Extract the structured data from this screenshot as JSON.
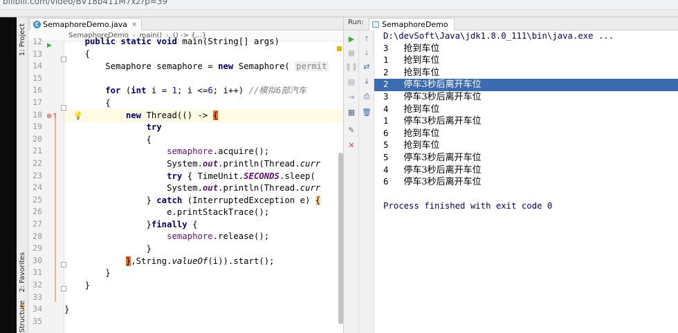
{
  "browser": {
    "url": "bilibili.com/video/BV18b411M7xz?p=39"
  },
  "sidebar": {
    "project_label": "1: Project",
    "favorites_label": "2: Favorites",
    "structure_label": "Structure"
  },
  "editor": {
    "tab_label": "SemaphoreDemo.java",
    "tab_close": "×",
    "file_icon": "c-class-icon",
    "breadcrumb": [
      "SemaphoreDemo",
      "main()",
      "() -> {...}"
    ],
    "crumb_sep": "›",
    "line_numbers": [
      "12",
      "13",
      "14",
      "15",
      "16",
      "17",
      "18",
      "19",
      "20",
      "21",
      "22",
      "23",
      "24",
      "25",
      "26",
      "27",
      "28",
      "29",
      "30",
      "31",
      "32",
      "33",
      "34",
      "35"
    ],
    "code": {
      "l12_a": "    ",
      "l12_kw": "public static void",
      "l12_b": " main(String[] args)",
      "l13": "    {",
      "l14_a": "        Semaphore semaphore = ",
      "l14_kw": "new",
      "l14_b": " Semaphore( ",
      "l14_hint": "permit",
      "l16_a": "        ",
      "l16_kw1": "for",
      "l16_b": " (",
      "l16_kw2": "int",
      "l16_c": " i = ",
      "l16_n1": "1",
      "l16_d": "; i <=",
      "l16_n2": "6",
      "l16_e": "; i++) ",
      "l16_cmt": "//模拟6部汽车",
      "l17": "        {",
      "l18_a": "            ",
      "l18_kw": "new",
      "l18_b": " Thread(() -> ",
      "l18_brace": "{",
      "l19_a": "                ",
      "l19_kw": "try",
      "l20": "                {",
      "l21_a": "                    ",
      "l21_fld": "semaphore",
      "l21_b": ".acquire();",
      "l22_a": "                    System.",
      "l22_fld": "out",
      "l22_b": ".println(Thread.",
      "l22_c": "curr",
      "l23_a": "                    ",
      "l23_kw": "try",
      "l23_b": " { TimeUnit.",
      "l23_fld": "SECONDS",
      "l23_c": ".sleep(",
      "l24_a": "                    System.",
      "l24_fld": "out",
      "l24_b": ".println(Thread.",
      "l24_c": "curr",
      "l25_a": "                } ",
      "l25_kw": "catch",
      "l25_b": " (InterruptedException e) ",
      "l25_brace": "{",
      "l26": "                    e.printStackTrace();",
      "l27_a": "                }",
      "l27_kw": "finally",
      "l27_b": " {",
      "l28_a": "                    ",
      "l28_fld": "semaphore",
      "l28_b": ".release();",
      "l29": "                }",
      "l30_a": "            ",
      "l30_brace": "}",
      "l30_b": ",String.",
      "l30_it": "valueOf",
      "l30_c": "(i)).start();",
      "l31": "        }",
      "l32": "    }",
      "l34": "}"
    }
  },
  "run_panel": {
    "label": "Run:",
    "tab_label": "SemaphoreDemo",
    "command": "D:\\devSoft\\Java\\jdk1.8.0_111\\bin\\java.exe ...",
    "output": [
      {
        "n": "3",
        "msg": "抢到车位"
      },
      {
        "n": "1",
        "msg": "抢到车位"
      },
      {
        "n": "2",
        "msg": "抢到车位"
      },
      {
        "n": "2",
        "msg": "停车3秒后离开车位"
      },
      {
        "n": "3",
        "msg": "停车3秒后离开车位"
      },
      {
        "n": "4",
        "msg": "抢到车位"
      },
      {
        "n": "1",
        "msg": "停车3秒后离开车位"
      },
      {
        "n": "6",
        "msg": "抢到车位"
      },
      {
        "n": "5",
        "msg": "抢到车位"
      },
      {
        "n": "5",
        "msg": "停车3秒后离开车位"
      },
      {
        "n": "4",
        "msg": "停车3秒后离开车位"
      },
      {
        "n": "6",
        "msg": "停车3秒后离开车位"
      }
    ],
    "exit_message": "Process finished with exit code 0",
    "toolbar_icons": [
      "rerun-icon",
      "stop-icon",
      "pause-icon",
      "dump-threads-icon",
      "settings-icon",
      "close-icon",
      "up-arrow-icon",
      "down-arrow-icon",
      "soft-wrap-icon",
      "scroll-to-end-icon",
      "print-icon",
      "trash-icon"
    ]
  },
  "colors": {
    "keyword": "#000080",
    "field": "#660e7a",
    "selection": "#3b6bb0",
    "current_line": "#fffae3",
    "run_green": "#3cad3c"
  }
}
